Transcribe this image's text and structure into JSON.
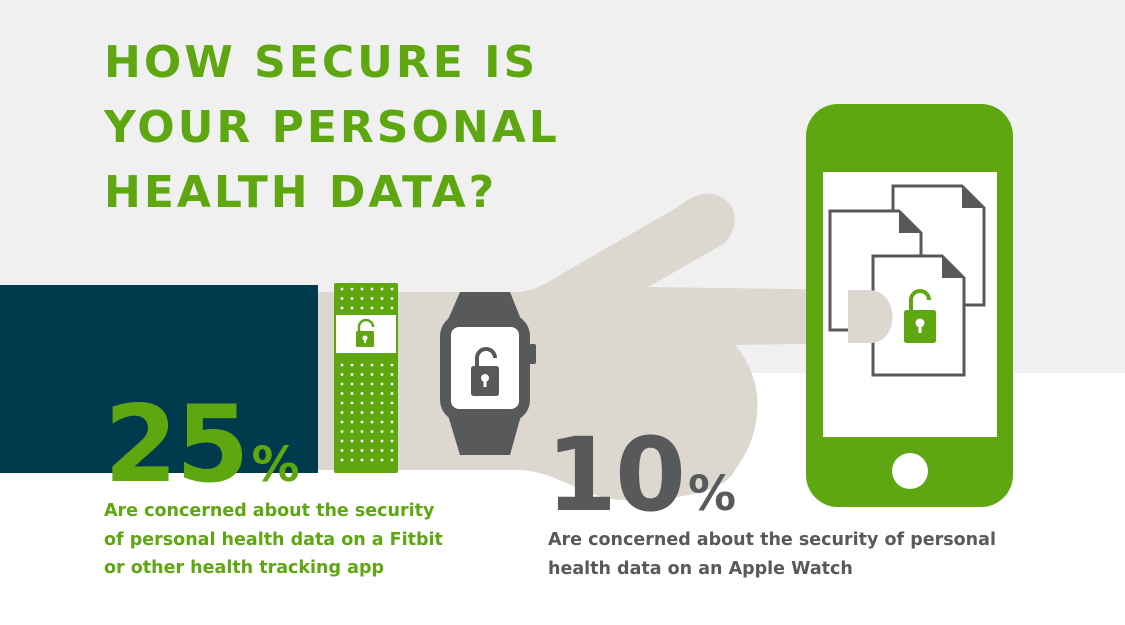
{
  "title": {
    "lines": [
      "HOW SECURE IS",
      "YOUR PERSONAL",
      "HEALTH DATA?"
    ]
  },
  "stats": {
    "fitbit": {
      "value": "25",
      "unit": "%",
      "description_lines": [
        "Are concerned about the security",
        "of personal health data on a Fitbit",
        "or other health tracking app"
      ]
    },
    "apple_watch": {
      "value": "10",
      "unit": "%",
      "description_lines": [
        "Are concerned about the security of personal",
        "health data on an Apple Watch"
      ]
    }
  },
  "icons": [
    "fitness-band-icon",
    "apple-watch-icon",
    "smartphone-icon",
    "padlock-open-icon",
    "documents-icon",
    "pointing-hand-icon"
  ],
  "colors": {
    "brand_green": "#5ea711",
    "dark_gray": "#58595b",
    "sleeve_navy": "#003a4d",
    "hand_beige": "#dcd8d0",
    "background_light": "#eff0ef",
    "background_white": "#ffffff"
  }
}
